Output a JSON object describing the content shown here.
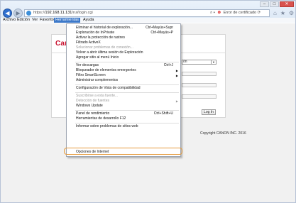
{
  "browser": {
    "url_prefix": "https://",
    "url_host": "192.168.11.131",
    "url_path": "/rui/login.cgi",
    "cert_error": "Error de certificado",
    "window_controls": [
      "–",
      "□",
      "✕"
    ]
  },
  "menubar": [
    "Archivo",
    "Edición",
    "Ver",
    "Favoritos",
    "Herramientas",
    "Ayuda"
  ],
  "page": {
    "logo": "Canon",
    "select_value": "ón",
    "login_button": "Log In",
    "copyright": "Copyright CANON INC. 2016"
  },
  "menu": {
    "items": [
      {
        "label": "Eliminar el historial de exploración...",
        "shortcut": "Ctrl+Mayús+Supr"
      },
      {
        "label": "Exploración de InPrivate",
        "shortcut": "Ctrl+Mayús+P"
      },
      {
        "label": "Activar la protección de rastreo",
        "shortcut": ""
      },
      {
        "label": "Filtrado ActiveX",
        "shortcut": ""
      },
      {
        "label": "Solucionar problemas de conexión...",
        "shortcut": ""
      },
      {
        "label": "Volver a abrir última sesión de Exploración",
        "shortcut": ""
      },
      {
        "label": "Agregar sitio al menú Inicio",
        "shortcut": ""
      },
      {
        "label": "Ver descargas",
        "shortcut": "Ctrl+J"
      },
      {
        "label": "Bloqueador de elementos emergentes",
        "shortcut": ""
      },
      {
        "label": "Filtro SmartScreen",
        "shortcut": ""
      },
      {
        "label": "Administrar complementos",
        "shortcut": ""
      },
      {
        "label": "Configuración de Vista de compatibilidad",
        "shortcut": ""
      },
      {
        "label": "Suscribirse a esta fuente...",
        "shortcut": ""
      },
      {
        "label": "Detección de fuentes",
        "shortcut": ""
      },
      {
        "label": "Windows Update",
        "shortcut": ""
      },
      {
        "label": "Panel de rendimiento",
        "shortcut": "Ctrl+Shift+U"
      },
      {
        "label": "Herramientas de desarrollo F12",
        "shortcut": ""
      },
      {
        "label": "Informar sobre problemas de sitios web",
        "shortcut": ""
      },
      {
        "label": "Opciones de Internet",
        "shortcut": ""
      }
    ]
  }
}
